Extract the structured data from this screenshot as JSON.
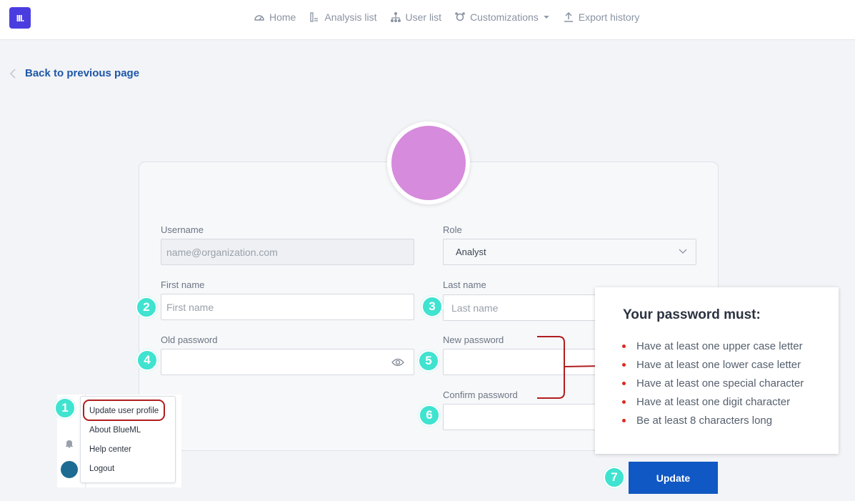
{
  "nav": {
    "logo_text": "III.",
    "items": [
      {
        "label": "Home",
        "icon": "gauge-icon"
      },
      {
        "label": "Analysis list",
        "icon": "list-icon"
      },
      {
        "label": "User list",
        "icon": "hierarchy-icon"
      },
      {
        "label": "Customizations",
        "icon": "customize-icon"
      },
      {
        "label": "Export history",
        "icon": "upload-icon"
      }
    ]
  },
  "back_link": "Back to previous page",
  "form": {
    "username_label": "Username",
    "username_value": "name@organization.com",
    "role_label": "Role",
    "role_value": "Analyst",
    "first_name_label": "First name",
    "first_name_placeholder": "First name",
    "last_name_label": "Last name",
    "last_name_placeholder": "Last name",
    "old_password_label": "Old password",
    "new_password_label": "New password",
    "confirm_password_label": "Confirm password"
  },
  "markers": [
    "1",
    "2",
    "3",
    "4",
    "5",
    "6",
    "7"
  ],
  "password_rules": {
    "title": "Your password must:",
    "items": [
      "Have at least one upper case letter",
      "Have at least one lower case letter",
      "Have at least one special character",
      "Have at least one digit character",
      "Be at least 8 characters long"
    ]
  },
  "update_button": "Update",
  "user_menu": {
    "items": [
      "Update user profile",
      "About BlueML",
      "Help center",
      "Logout"
    ]
  },
  "colors": {
    "accent": "#1058c4",
    "logo": "#4a3de0",
    "marker": "#3fe3d0",
    "avatar": "#d68bdc",
    "highlight": "#b01e1e"
  }
}
